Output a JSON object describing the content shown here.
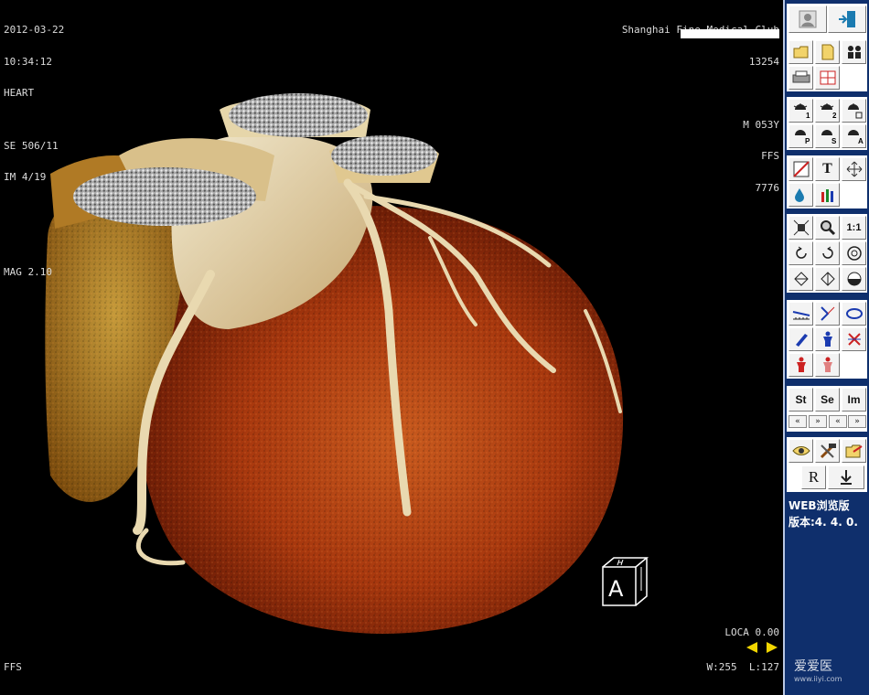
{
  "overlay": {
    "top_left": [
      "2012-03-22",
      "10:34:12",
      "HEART",
      "",
      "SE 506/11",
      "IM 4/19",
      "",
      "",
      "MAG 2.10"
    ],
    "top_right": [
      "Shanghai Fine Medical Club",
      "13254",
      "",
      "M 053Y",
      "FFS",
      "7776"
    ],
    "bottom_left": "FFS",
    "loca": "LOCA 0.00",
    "window": "W:255  L:127"
  },
  "cube_label": "A",
  "toolbar": {
    "text_tool": "T",
    "actual_size": "1:1",
    "series_st": "St",
    "series_se": "Se",
    "series_im": "Im",
    "nav": [
      "«",
      "»",
      "«",
      "»"
    ],
    "reset": "R"
  },
  "version": {
    "line1": "WEB浏览版",
    "line2": "版本:4. 4. 0."
  },
  "watermark": {
    "text": "爱爱医",
    "url": "www.iiyi.com"
  },
  "colors": {
    "toolbar_bg": "#0f2f6c",
    "overlay_text": "#dcdcdc",
    "nav_arrow": "#f2d600"
  }
}
